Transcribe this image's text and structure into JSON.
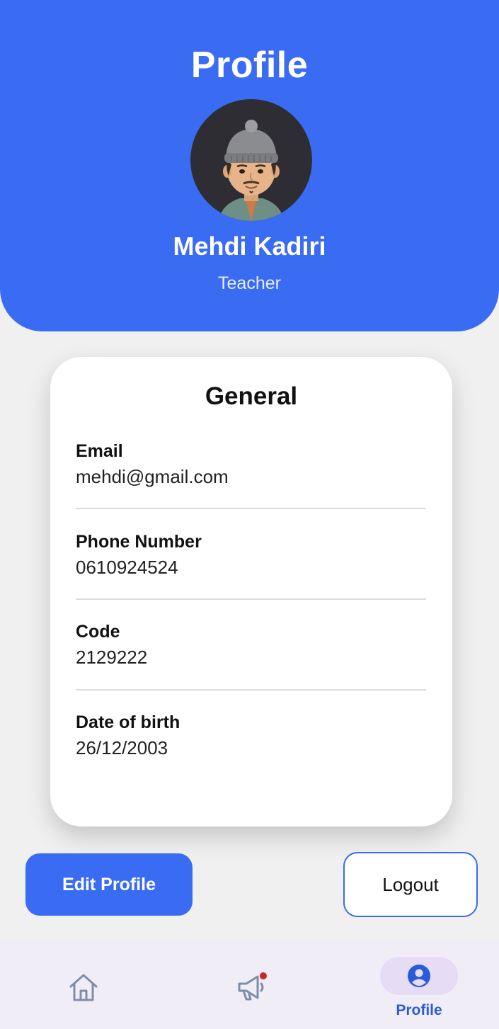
{
  "header": {
    "title": "Profile",
    "name": "Mehdi Kadiri",
    "role": "Teacher",
    "avatar_icon": "memoji-avatar-icon"
  },
  "general": {
    "title": "General",
    "fields": [
      {
        "label": "Email",
        "value": "mehdi@gmail.com"
      },
      {
        "label": "Phone Number",
        "value": "0610924524"
      },
      {
        "label": "Code",
        "value": "2129222"
      },
      {
        "label": "Date of birth",
        "value": "26/12/2003"
      }
    ]
  },
  "actions": {
    "edit_label": "Edit Profile",
    "logout_label": "Logout"
  },
  "nav": {
    "items": [
      {
        "icon": "home-icon",
        "label": ""
      },
      {
        "icon": "megaphone-icon",
        "label": "",
        "has_notification_dot": true
      },
      {
        "icon": "account-circle-icon",
        "label": "Profile",
        "active": true
      }
    ]
  },
  "colors": {
    "primary": "#3a6cf3",
    "background": "#f0f0f0",
    "nav_background": "#f1edf6",
    "nav_active_pill": "#e6dcf6",
    "notification_dot": "#c62828"
  }
}
